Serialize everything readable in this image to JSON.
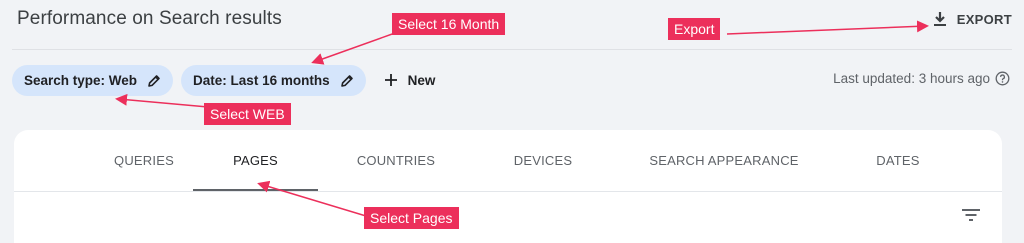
{
  "header": {
    "title": "Performance on Search results",
    "export_label": "EXPORT"
  },
  "filters": {
    "chips": [
      {
        "label": "Search type: Web",
        "icon": "pencil-icon"
      },
      {
        "label": "Date: Last 16 months",
        "icon": "pencil-icon"
      }
    ],
    "new_label": "New"
  },
  "status": {
    "last_updated": "Last updated: 3 hours ago"
  },
  "tabs": [
    {
      "label": "QUERIES",
      "active": false
    },
    {
      "label": "PAGES",
      "active": true
    },
    {
      "label": "COUNTRIES",
      "active": false
    },
    {
      "label": "DEVICES",
      "active": false
    },
    {
      "label": "SEARCH APPEARANCE",
      "active": false
    },
    {
      "label": "DATES",
      "active": false
    }
  ],
  "annotations": {
    "select_16_month": "Select 16 Month",
    "export": "Export",
    "select_web": "Select WEB",
    "select_pages": "Select Pages"
  },
  "colors": {
    "annotation": "#ec2f5b",
    "chip_bg": "#d5e5fb",
    "page_bg": "#f1f3f6"
  }
}
